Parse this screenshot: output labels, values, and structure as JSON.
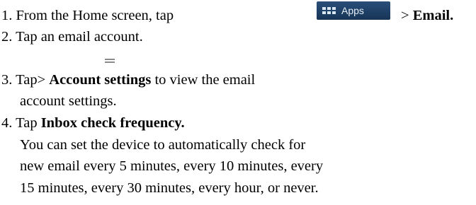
{
  "steps": {
    "s1_text": "1. From the Home screen, tap",
    "s1_button": "Apps",
    "s1_after_prefix": "> ",
    "s1_after_bold": "Email.",
    "s2_text": "2. Tap an email account.",
    "s3_prefix": "3. Tap> ",
    "s3_bold": "Account settings",
    "s3_suffix": " to view the email",
    "s3_cont": "account settings.",
    "s4_prefix": "4. Tap ",
    "s4_bold": "Inbox check frequency.",
    "s4_body1": "You can set the device to automatically check for",
    "s4_body2": "new email every 5 minutes, every 10 minutes, every",
    "s4_body3": "15 minutes, every 30 minutes, every hour, or never."
  },
  "icons": {
    "apps": "apps-grid-icon",
    "menu": "menu-icon"
  }
}
